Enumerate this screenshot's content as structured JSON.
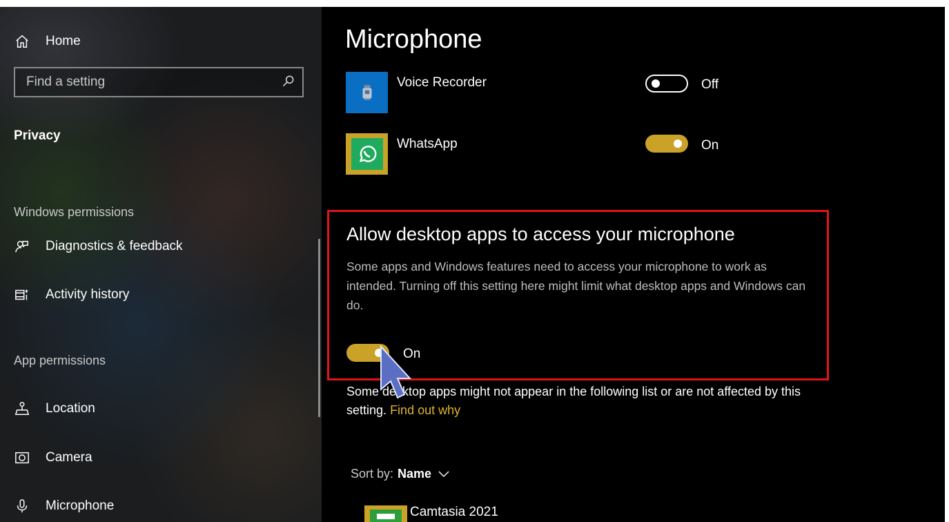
{
  "sidebar": {
    "home_label": "Home",
    "search_placeholder": "Find a setting",
    "category": "Privacy",
    "windows_permissions_title": "Windows permissions",
    "windows_items": [
      {
        "label": "Diagnostics & feedback",
        "icon": "diagnostics-icon"
      },
      {
        "label": "Activity history",
        "icon": "activity-history-icon"
      }
    ],
    "app_permissions_title": "App permissions",
    "app_items": [
      {
        "label": "Location",
        "icon": "location-icon"
      },
      {
        "label": "Camera",
        "icon": "camera-icon"
      },
      {
        "label": "Microphone",
        "icon": "microphone-icon"
      }
    ]
  },
  "main": {
    "title": "Microphone",
    "apps": [
      {
        "name": "Voice Recorder",
        "toggle_state": "Off",
        "icon": "voice-recorder-icon",
        "icon_color": "#0a6fc2"
      },
      {
        "name": "WhatsApp",
        "toggle_state": "On",
        "icon": "whatsapp-icon",
        "icon_color": "#c9a227"
      }
    ],
    "desktop_section": {
      "heading": "Allow desktop apps to access your microphone",
      "description": "Some apps and Windows features need to access your microphone to work as intended. Turning off this setting here might limit what desktop apps and Windows can do.",
      "toggle_state": "On"
    },
    "note_text": "Some desktop apps might not appear in the following list or are not affected by this setting.",
    "note_link": "Find out why",
    "sort_label": "Sort by:",
    "sort_value": "Name",
    "desktop_apps": [
      {
        "name": "Camtasia 2021",
        "icon": "camtasia-icon"
      }
    ]
  },
  "colors": {
    "accent": "#c9a227",
    "link": "#e0b530",
    "highlight_border": "#e3121b"
  }
}
